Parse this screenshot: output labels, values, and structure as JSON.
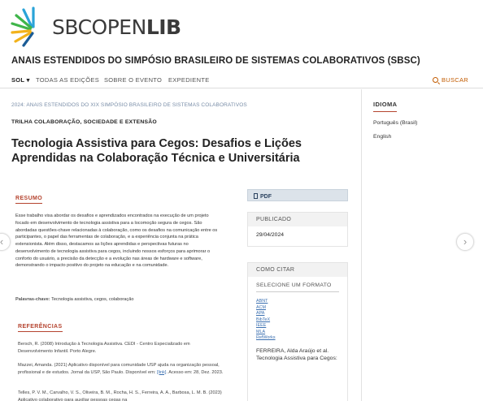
{
  "brand": {
    "logo_part1": "SBC",
    "logo_part2": "OPEN",
    "logo_part3": "LIB",
    "site_title": "ANAIS ESTENDIDOS DO SIMPÓSIO BRASILEIRO DE SISTEMAS COLABORATIVOS (SBSC)",
    "accent_color": "#b5442f"
  },
  "nav": {
    "sol": "SOL",
    "items": [
      "TODAS AS EDIÇÕES",
      "SOBRE O EVENTO",
      "EXPEDIENTE"
    ],
    "search": "BUSCAR"
  },
  "article": {
    "breadcrumb": "2024: ANAIS ESTENDIDOS DO XIX SIMPÓSIO BRASILEIRO DE SISTEMAS COLABORATIVOS",
    "section": "TRILHA COLABORAÇÃO, SOCIEDADE E EXTENSÃO",
    "title": "Tecnologia Assistiva para Cegos: Desafios e Lições Aprendidas na Colaboração Técnica e Universitária",
    "abstract_heading": "RESUMO",
    "abstract": "Esse trabalho visa abordar os desafios e aprendizados encontrados na execução de um projeto focado em desenvolvimento de tecnologia assistiva para a locomoção segura de cegos. São abordadas questões-chave relacionadas à colaboração, como os desafios na comunicação entre os participantes, o papel das ferramentas de colaboração, e a experiência conjunta na prática extensionista. Além disso, destacamos as lições aprendidas e perspectivas futuras no desenvolvimento de tecnologia assistiva para cegos, incluindo nossos esforços para aprimorar o conforto do usuário, a precisão da detecção e a evolução nas áreas de hardware e software, demonstrando o impacto positivo do projeto na educação e na comunidade.",
    "keywords_label": "Palavras-chave:",
    "keywords": "Tecnologia assistiva, cegos, colaboração",
    "references_heading": "REFERÊNCIAS",
    "ref1": "Bersch, R. (2008) Introdução à Tecnologia Assistiva. CEDI - Centro Especializado em Desenvolvimento Infantil. Porto Alegre.",
    "ref2_pre": "Mazzei, Amanda. (2021) Aplicativo disponível para comunidade USP ajuda na organização pessoal, profissional e de estudos. Jornal da USP, São Paulo. Disponível em:",
    "ref2_link": "[link]",
    "ref2_post": ". Acesso em: 28, Dez. 2023.",
    "ref3": "Telles, P. V. M., Carvalho, V. S., Oliveira, B. M., Rocha, H. S., Ferreira, A. A., Barbosa, L. M. B. (2023) Aplicativo colaborativo para auxiliar pessoas cegas na"
  },
  "sidebar": {
    "pdf": "PDF",
    "published_label": "PUBLICADO",
    "published_date": "29/04/2024",
    "cite_label": "COMO CITAR",
    "format_label": "SELECIONE UM FORMATO",
    "formats": [
      "ABNT",
      "ACM",
      "APA",
      "BibTeX",
      "IEEE",
      "MLA",
      "RefWorks"
    ],
    "citation": "FERREIRA, Alda Araújo et al. Tecnologia Assistiva para Cegos:"
  },
  "language": {
    "heading": "IDIOMA",
    "options": [
      "Português (Brasil)",
      "English"
    ]
  },
  "carousel": {
    "prev": "‹",
    "next": "›"
  }
}
